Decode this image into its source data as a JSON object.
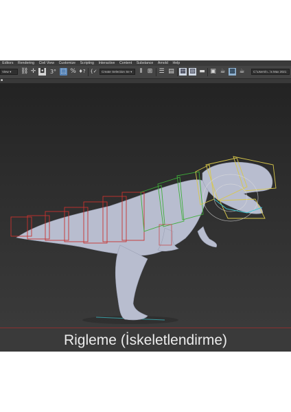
{
  "menubar": {
    "items": [
      "Editors",
      "Rendering",
      "Civil View",
      "Customize",
      "Scripting",
      "Interactive",
      "Content",
      "Substance",
      "Arnold",
      "Help"
    ]
  },
  "toolbar": {
    "view_dropdown": "View",
    "selection_set_placeholder": "Create Selection Se",
    "path_display": "C:\\Users\\n...\\s Max 2021",
    "icons": [
      "link-icon",
      "move-icon",
      "select-object-icon",
      "angle-snap-icon",
      "select-region-icon",
      "percent-snap-icon",
      "spinner-snap-icon",
      "named-selection-icon",
      "mirror-icon",
      "align-icon",
      "layer-explorer-icon",
      "ribbon-icon",
      "curve-editor-icon",
      "schematic-view-icon",
      "material-editor-icon",
      "render-setup-icon",
      "render-frame-icon",
      "render-icon",
      "render-production-icon"
    ]
  },
  "caption": {
    "text": "Rigleme (İskeletlendirme)"
  },
  "colors": {
    "bone_red": "#c8322f",
    "bone_green": "#3fae3a",
    "bone_yellow": "#d9c84a",
    "bone_cyan": "#3ec7d0",
    "model": "#b8bdcf"
  }
}
